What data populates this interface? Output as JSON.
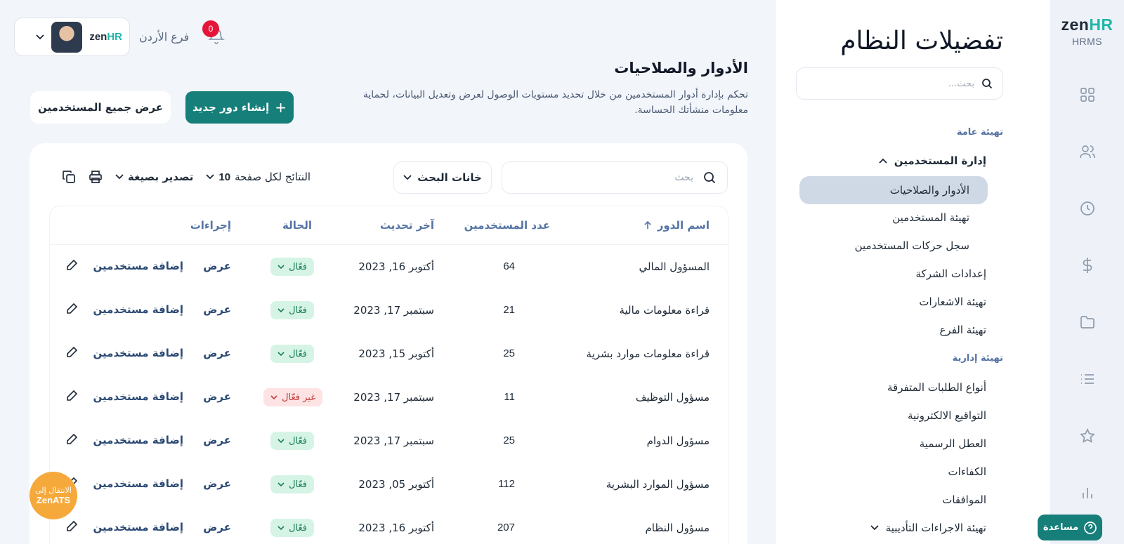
{
  "rail": {
    "logo_zen": "zen",
    "logo_hr": "HR",
    "logo_sub": "HRMS",
    "icons": [
      "dashboard-icon",
      "users-icon",
      "clock-icon",
      "dollar-icon",
      "folder-icon",
      "list-icon",
      "star-icon",
      "chart-icon"
    ]
  },
  "settings": {
    "title": "تفضيلات النظام",
    "search_placeholder": "بحث...",
    "group_general": "تهيئة عامة",
    "user_management": "إدارة المستخدمين",
    "items_general": [
      "الأدوار والصلاحيات",
      "تهيئة المستخدمين",
      "سجل حركات المستخدمين",
      "إعدادات الشركة",
      "تهيئة الاشعارات",
      "تهيئة الفرع"
    ],
    "group_admin": "تهيئة إدارية",
    "items_admin": [
      "أنواع الطلبات المتفرقة",
      "التواقيع الالكترونية",
      "العطل الرسمية",
      "الكفاءات",
      "الموافقات",
      "تهيئة الاجراءات التأديبية"
    ]
  },
  "header": {
    "notifications_count": "0",
    "branch": "فرع الأردن",
    "mini_logo_zen": "zen",
    "mini_logo_hr": "HR"
  },
  "page": {
    "title": "الأدوار والصلاحيات",
    "description": "تحكم بإدارة أدوار المستخدمين من خلال تحديد مستويات الوصول لعرض وتعديل البيانات، لحماية معلومات منشأتك الحساسة.",
    "create_button": "إنشاء دور جديد",
    "view_all_button": "عرض جميع المستخدمين"
  },
  "table_tools": {
    "search_placeholder": "بحث",
    "fields_button": "خانات البحث",
    "export_label": "تصدير بصيغة",
    "per_page_label": "النتائج لكل صفحة",
    "per_page_value": "10"
  },
  "table": {
    "headers": {
      "name": "اسم الدور",
      "users": "عدد المستخدمين",
      "updated": "آخر تحديث",
      "status": "الحالة",
      "actions": "إجراءات"
    },
    "view_label": "عرض",
    "add_users_label": "إضافة مستخدمين",
    "rows": [
      {
        "name": "المسؤول المالي",
        "users": "64",
        "updated": "أكتوبر 16, 2023",
        "status": "فعّال",
        "active": true
      },
      {
        "name": "قراءة معلومات مالية",
        "users": "21",
        "updated": "سبتمبر 17, 2023",
        "status": "فعّال",
        "active": true
      },
      {
        "name": "قراءة معلومات موارد بشرية",
        "users": "25",
        "updated": "أكتوبر 15, 2023",
        "status": "فعّال",
        "active": true
      },
      {
        "name": "مسؤول التوظيف",
        "users": "11",
        "updated": "سبتمبر 17, 2023",
        "status": "غير فعّال",
        "active": false
      },
      {
        "name": "مسؤول الدوام",
        "users": "25",
        "updated": "سبتمبر 17, 2023",
        "status": "فعّال",
        "active": true
      },
      {
        "name": "مسؤول الموارد البشرية",
        "users": "112",
        "updated": "أكتوبر 05, 2023",
        "status": "فعّال",
        "active": true
      },
      {
        "name": "مسؤول النظام",
        "users": "207",
        "updated": "أكتوبر 16, 2023",
        "status": "فعّال",
        "active": true
      }
    ]
  },
  "ats_button": {
    "line1": "الانتقال إلى",
    "line2": "ZenATS"
  },
  "help_button": "مساعدة",
  "colors": {
    "primary": "#167f7a",
    "accent": "#1fb6a8",
    "active_bg": "#d6f4e6",
    "inactive_bg": "#fde3e3",
    "badge": "#e5153a"
  }
}
